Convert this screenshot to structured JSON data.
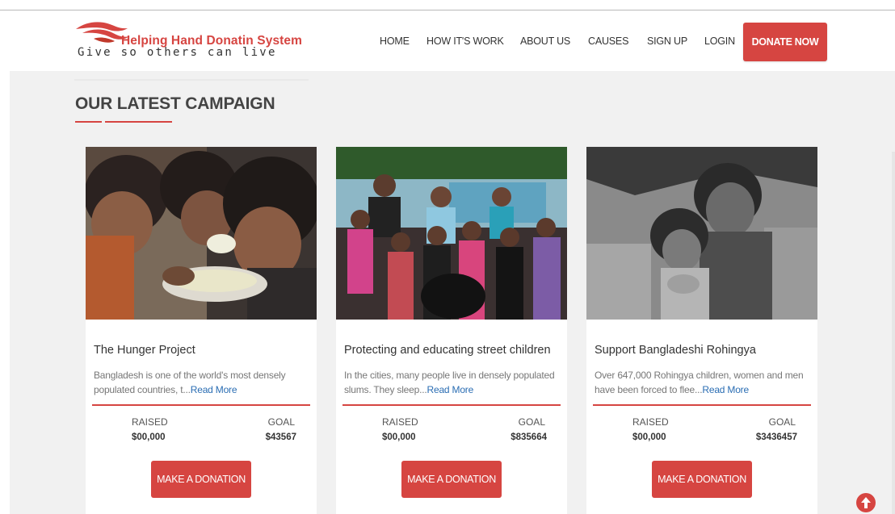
{
  "brand": {
    "title": "Helping Hand Donatin System",
    "tagline": "Give so others can live"
  },
  "nav": {
    "items": [
      "HOME",
      "HOW IT'S WORK",
      "ABOUT US",
      "CAUSES",
      "SIGN UP",
      "LOGIN"
    ],
    "cta": "DONATE NOW"
  },
  "section": {
    "title": "OUR LATEST CAMPAIGN"
  },
  "campaigns": [
    {
      "title": "The Hunger Project",
      "desc": "Bangladesh is one of the world's most densely populated countries, t...",
      "read_more": "Read More",
      "raised_label": "RAISED",
      "raised": "$00,000",
      "goal_label": "GOAL",
      "goal": "$43567",
      "button": "MAKE A DONATION"
    },
    {
      "title": "Protecting and educating street children",
      "desc": "In the cities, many people live in densely populated slums. They sleep...",
      "read_more": "Read More",
      "raised_label": "RAISED",
      "raised": "$00,000",
      "goal_label": "GOAL",
      "goal": "$835664",
      "button": "MAKE A DONATION"
    },
    {
      "title": "Support Bangladeshi Rohingya",
      "desc": "Over 647,000 Rohingya children, women and men have been forced to flee...",
      "read_more": "Read More",
      "raised_label": "RAISED",
      "raised": "$00,000",
      "goal_label": "GOAL",
      "goal": "$3436457",
      "button": "MAKE A DONATION"
    }
  ],
  "colors": {
    "accent": "#d64541",
    "link": "#2a6db3",
    "page_bg": "#f1f1f1"
  },
  "icons": {
    "scroll_top": "arrow-up-circle-icon"
  }
}
